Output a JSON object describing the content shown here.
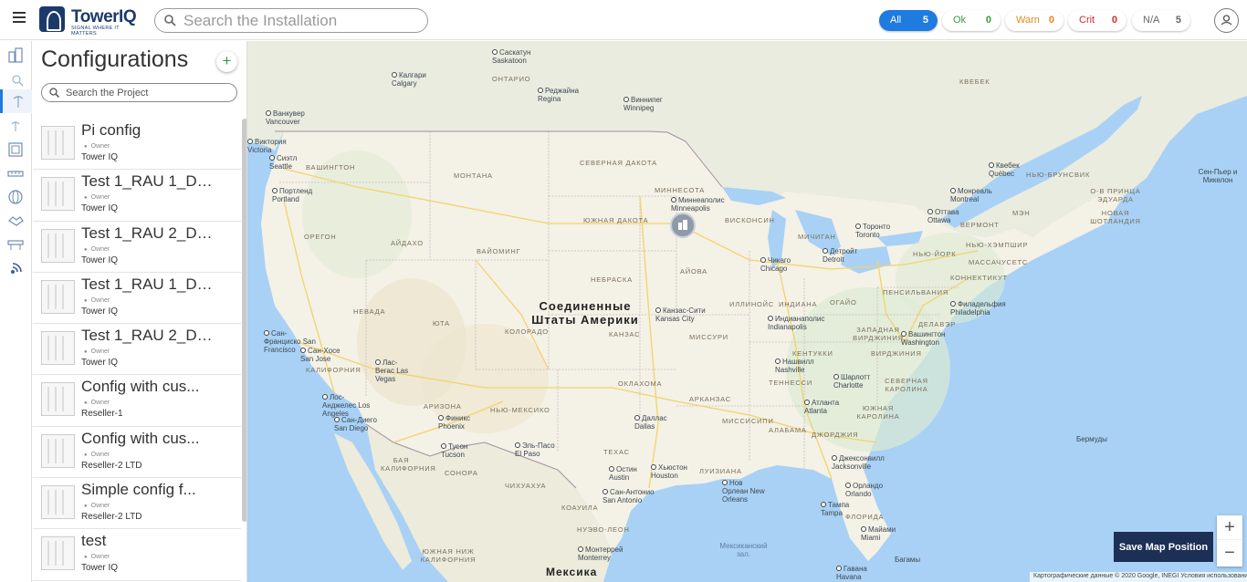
{
  "header": {
    "brand": "TowerIQ",
    "tagline": "SIGNAL WHERE IT MATTERS",
    "search_placeholder": "Search the Installation",
    "filters": [
      {
        "label": "All",
        "count": "5"
      },
      {
        "label": "Ok",
        "count": "0"
      },
      {
        "label": "Warn",
        "count": "0"
      },
      {
        "label": "Crit",
        "count": "0"
      },
      {
        "label": "N/A",
        "count": "5"
      }
    ]
  },
  "sidebar_icons": [
    "building-icon",
    "search-map-icon",
    "antenna-icon",
    "antenna-signal-icon",
    "floorplan-icon",
    "ruler-icon",
    "globe-icon",
    "handshake-icon",
    "rack-icon",
    "signal-icon"
  ],
  "panel": {
    "title": "Configurations",
    "add_label": "+",
    "search_placeholder": "Search the Project",
    "owner_label": "Owner",
    "configs": [
      {
        "name": "Pi config",
        "owner": "Tower IQ"
      },
      {
        "name": "Test 1_RAU 1_DR...",
        "owner": "Tower IQ"
      },
      {
        "name": "Test 1_RAU 2_DR...",
        "owner": "Tower IQ"
      },
      {
        "name": "Test 1_RAU 1_DR...",
        "owner": "Tower IQ"
      },
      {
        "name": "Test 1_RAU 2_DR...",
        "owner": "Tower IQ"
      },
      {
        "name": "Config with cus...",
        "owner": "Reseller-1"
      },
      {
        "name": "Config with cus...",
        "owner": "Reseller-2 LTD"
      },
      {
        "name": "Simple config f...",
        "owner": "Reseller-2 LTD"
      },
      {
        "name": "test",
        "owner": "Tower IQ"
      }
    ]
  },
  "map": {
    "country": "Соединенные Штаты Америки",
    "mexico": "Мексика",
    "labels": {
      "ontario": "ОНТАРИО",
      "quebec": "КВЕБЕК",
      "montana": "МОНТАНА",
      "washington": "ВАШИНГТОН",
      "oregon": "ОРЕГОН",
      "idaho": "АЙДАХО",
      "wyoming": "ВАЙОМИНГ",
      "nevada": "НЕВАДА",
      "utah": "ЮТА",
      "colorado": "КОЛОРАДО",
      "california": "КАЛИФОРНИЯ",
      "arizona": "АРИЗОНА",
      "newmexico": "НЬЮ-МЕКСИКО",
      "texas": "ТЕХАС",
      "oklahoma": "ОКЛАХОМА",
      "kansas": "КАНЗАС",
      "nebraska": "НЕБРАСКА",
      "southdakota": "ЮЖНАЯ ДАКОТА",
      "northdakota": "СЕВЕРНАЯ ДАКОТА",
      "minnesota": "МИННЕСОТА",
      "iowa": "АЙОВА",
      "missouri": "МИССУРИ",
      "arkansas": "АРКАНЗАС",
      "louisiana": "ЛУИЗИАНА",
      "mississippi": "МИССИСИПИ",
      "alabama": "АЛАБАМА",
      "georgia": "ДЖОРДЖИЯ",
      "florida": "ФЛОРИДА",
      "tennessee": "ТЕННЕССИ",
      "kentucky": "КЕНТУККИ",
      "illinois": "ИЛЛИНОЙС",
      "indiana": "ИНДИАНА",
      "ohio": "ОГАЙО",
      "michigan": "МИЧИГАН",
      "wisconsin": "ВИСКОНСИН",
      "pennsylvania": "ПЕНСИЛЬВАНИЯ",
      "newyork": "НЬЮ-ЙОРК",
      "virginia": "ВИРДЖИНИЯ",
      "westvirginia": "ЗАПАДНАЯ ВИРДЖИНИЯ",
      "northcarolina": "СЕВЕРНАЯ КАРОЛИНА",
      "southcarolina": "ЮЖНАЯ КАРОЛИНА",
      "maine": "МЭН",
      "vermont": "ВЕРМОНТ",
      "newhampshire": "НЬЮ-ХЭМПШИР",
      "massachusetts": "МАССАЧУСЕТС",
      "connecticut": "КОННЕКТИКУТ",
      "delaware": "ДЕЛАВЭР",
      "newbrunswick": "НЬЮ-БРУНСВИК",
      "pei": "О-В ПРИНЦА ЭДУАРДА",
      "novascotia": "НОВАЯ ШОТЛАНДИЯ",
      "baja": "БАЯ КАЛИФОРНИЯ",
      "sonora": "СОНОРА",
      "chihuahua": "ЧИХУАХУА",
      "coahuila": "КОАУИЛА",
      "nuevoleon": "НУЭВО-ЛЕОН",
      "bajasur": "ЮЖНАЯ НИЖ КАЛИФОРНИЯ"
    },
    "cities": {
      "calgary": "Калгари Calgary",
      "saskatoon": "Саскатун Saskatoon",
      "regina": "Реджайна Regina",
      "winnipeg": "Виннипег Winnipeg",
      "vancouver": "Ванкувер Vancouver",
      "victoria": "Виктория Victoria",
      "seattle": "Сиэтл Seattle",
      "portland": "Портленд Portland",
      "minneapolis": "Миннеаполис Minneapolis",
      "chicago": "Чикаго Chicago",
      "detroit": "Детройт Detroit",
      "toronto": "Торонто Toronto",
      "ottawa": "Оттава Ottawa",
      "montreal": "Монреаль Montreal",
      "quebeccity": "Квебек Québec",
      "kansascity": "Канзас-Сити Kansas City",
      "indianapolis": "Индианаполис Indianapolis",
      "philadelphia": "Филадельфия Philadelphia",
      "washington": "Вашингтон Washington",
      "nashville": "Нашвилл Nashville",
      "charlotte": "Шарлотт Charlotte",
      "atlanta": "Атланта Atlanta",
      "dallas": "Даллас Dallas",
      "austin": "Остин Austin",
      "houston": "Хьюстон Houston",
      "sanantonio": "Сан-Антонио San Antonio",
      "neworleans": "Нов Орлеан New Orleans",
      "jacksonville": "Джексонвилл Jacksonville",
      "orlando": "Орландо Orlando",
      "tampa": "Тампа Tampa",
      "miami": "Майами Miami",
      "havana": "Гавана Havana",
      "elpaso": "Эль-Пасо El Paso",
      "tucson": "Тусон Tucson",
      "phoenix": "Финикс Phoenix",
      "lasvegas": "Лас-Вегас Las Vegas",
      "losangeles": "Лос-Анджелес Los Angeles",
      "sandiego": "Сан-Диего San Diego",
      "sanfrancisco": "Сан-Франциско San Francisco",
      "sanjose": "Сан-Хосе San Jose",
      "monterrey": "Монтеррей Monterrey",
      "bermuda": "Бермуды",
      "bahamas": "Багамы",
      "gulf": "Мексиканский зал.",
      "stpierre": "Сен-Пьер и Микелон"
    },
    "save_label": "Save Map Position",
    "zoom_in": "+",
    "zoom_out": "−",
    "attribution": "Картографические данные © 2020 Google, INEGI   Условия использования"
  }
}
